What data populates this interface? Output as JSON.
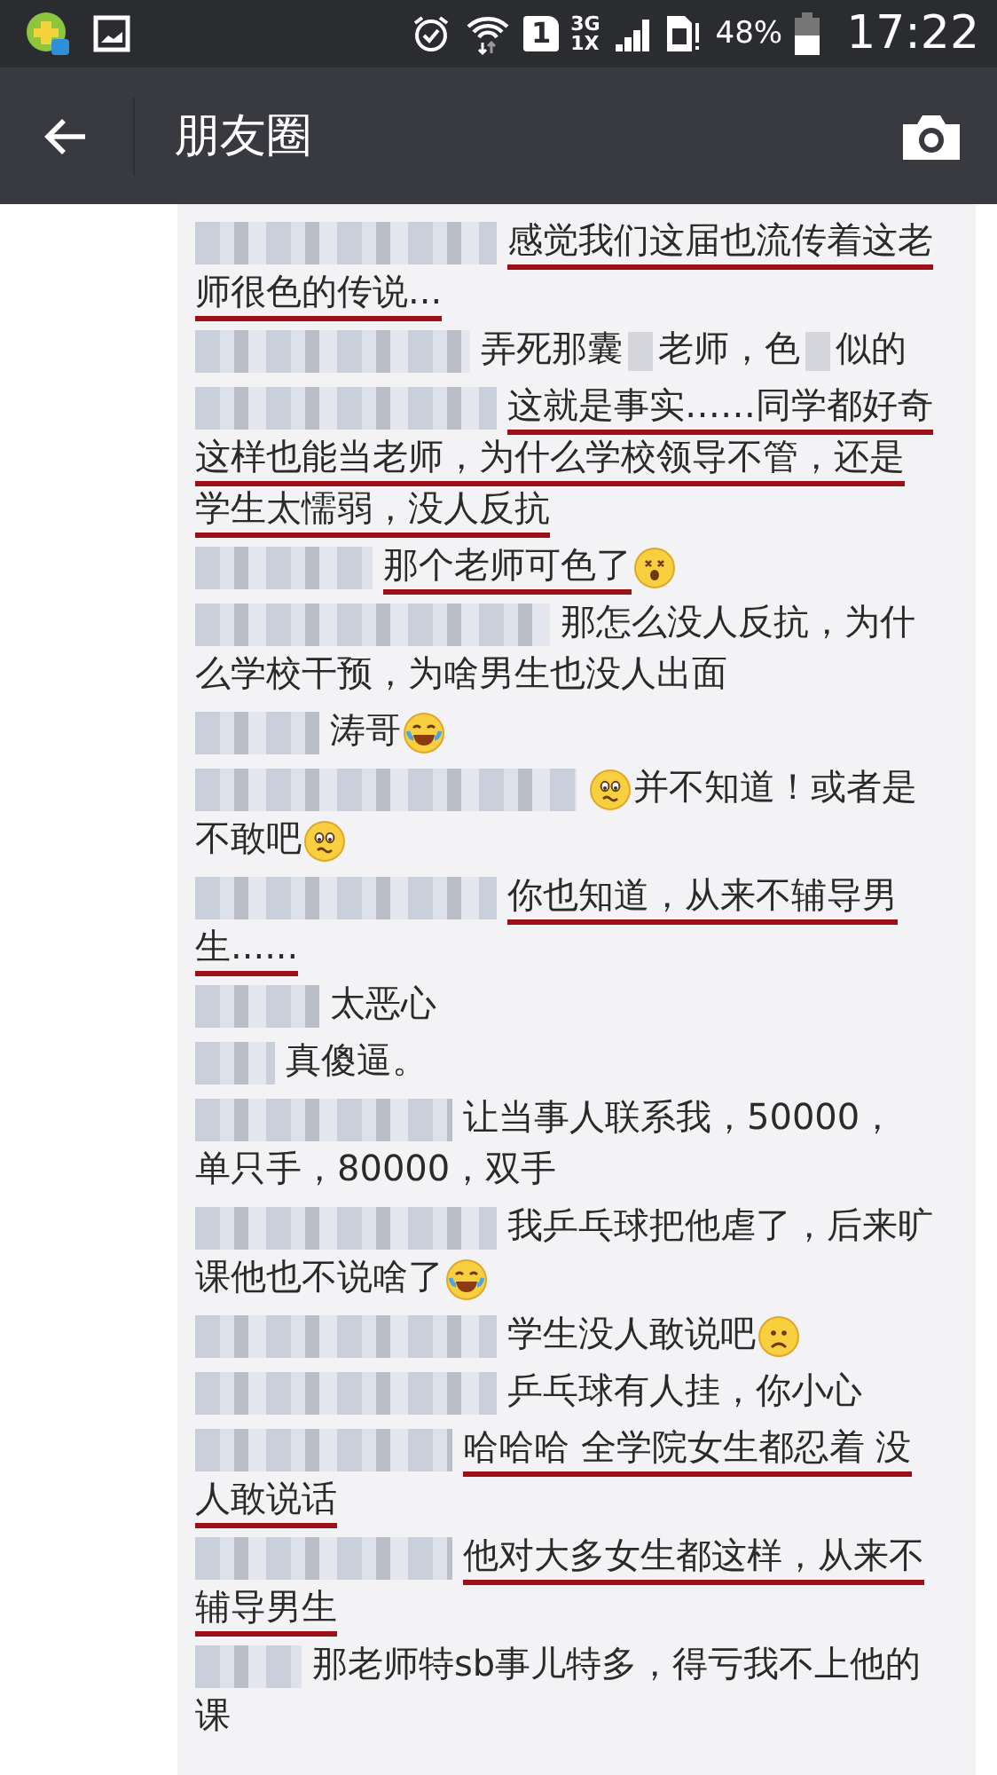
{
  "status_bar": {
    "sim_slot": "1",
    "network_top": "3G",
    "network_bottom": "1X",
    "battery": "48%",
    "time": "17:22"
  },
  "header": {
    "title": "朋友圈"
  },
  "comments": [
    {
      "marked": true,
      "lines": [
        [
          {
            "kind": "text",
            "text": "感觉我们这届也流传着这老"
          }
        ],
        [
          {
            "kind": "text",
            "text": "师很色的传说..."
          }
        ]
      ]
    },
    {
      "marked": false,
      "lines": [
        [
          {
            "kind": "text",
            "text": "弄死那囊"
          },
          {
            "kind": "redaction"
          },
          {
            "kind": "text",
            "text": "老师，色"
          },
          {
            "kind": "redaction"
          },
          {
            "kind": "text",
            "text": "似的"
          }
        ]
      ]
    },
    {
      "marked": true,
      "lines": [
        [
          {
            "kind": "text",
            "text": "这就是事实……同学都好奇"
          }
        ],
        [
          {
            "kind": "text",
            "text": "这样也能当老师，为什么学校领导不管，还是"
          }
        ],
        [
          {
            "kind": "text",
            "text": "学生太懦弱，没人反抗"
          }
        ]
      ]
    },
    {
      "marked": true,
      "lines": [
        [
          {
            "kind": "text",
            "text": "那个老师可色了"
          },
          {
            "kind": "dizzy"
          }
        ]
      ]
    },
    {
      "marked": false,
      "lines": [
        [
          {
            "kind": "text",
            "text": "那怎么没人反抗，为什"
          }
        ],
        [
          {
            "kind": "text",
            "text": "么学校干预，为啥男生也没人出面"
          }
        ]
      ]
    },
    {
      "marked": false,
      "lines": [
        [
          {
            "kind": "text",
            "text": "涛哥"
          },
          {
            "kind": "tears"
          }
        ]
      ]
    },
    {
      "marked": false,
      "lines": [
        [
          {
            "kind": "worried"
          },
          {
            "kind": "text",
            "text": "并不知道！或者是"
          }
        ],
        [
          {
            "kind": "text",
            "text": "不敢吧"
          },
          {
            "kind": "worried"
          }
        ]
      ]
    },
    {
      "marked": true,
      "lines": [
        [
          {
            "kind": "text",
            "text": "你也知道，从来不辅导男"
          }
        ],
        [
          {
            "kind": "text",
            "text": "生......"
          }
        ]
      ]
    },
    {
      "marked": false,
      "lines": [
        [
          {
            "kind": "text",
            "text": "太恶心"
          }
        ]
      ]
    },
    {
      "marked": false,
      "lines": [
        [
          {
            "kind": "text",
            "text": "真傻逼。"
          }
        ]
      ]
    },
    {
      "marked": false,
      "lines": [
        [
          {
            "kind": "text",
            "text": "让当事人联系我，50000，"
          }
        ],
        [
          {
            "kind": "text",
            "text": "单只手，80000，双手"
          }
        ]
      ]
    },
    {
      "marked": false,
      "lines": [
        [
          {
            "kind": "text",
            "text": "我乒乓球把他虐了，后来旷"
          }
        ],
        [
          {
            "kind": "text",
            "text": "课他也不说啥了"
          },
          {
            "kind": "tears"
          }
        ]
      ]
    },
    {
      "marked": false,
      "lines": [
        [
          {
            "kind": "text",
            "text": "学生没人敢说吧"
          },
          {
            "kind": "frown"
          }
        ]
      ]
    },
    {
      "marked": false,
      "lines": [
        [
          {
            "kind": "text",
            "text": "乒乓球有人挂，你小心"
          }
        ]
      ]
    },
    {
      "marked": true,
      "lines": [
        [
          {
            "kind": "text",
            "text": "哈哈哈 全学院女生都忍着 没"
          }
        ],
        [
          {
            "kind": "text",
            "text": "人敢说话"
          }
        ]
      ]
    },
    {
      "marked": true,
      "lines": [
        [
          {
            "kind": "text",
            "text": "他对大多女生都这样，从来不"
          }
        ],
        [
          {
            "kind": "text",
            "text": "辅导男生"
          }
        ]
      ]
    },
    {
      "marked": false,
      "lines": [
        [
          {
            "kind": "text",
            "text": "那老师特sb事儿特多，得亏我不上他的"
          }
        ],
        [
          {
            "kind": "text",
            "text": "课"
          }
        ]
      ]
    }
  ]
}
